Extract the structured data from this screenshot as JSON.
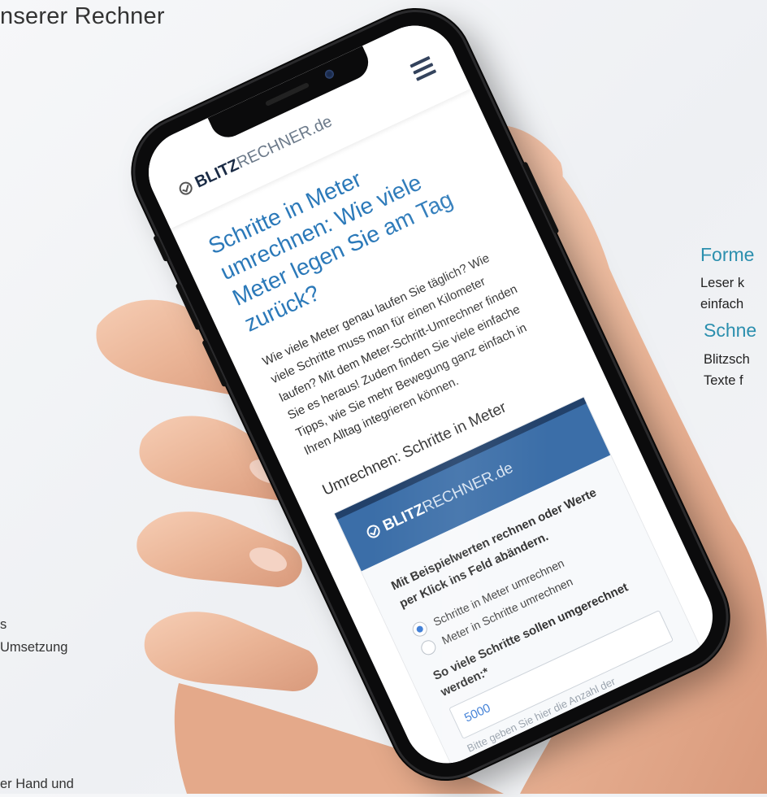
{
  "page": {
    "heading": "nserer Rechner",
    "features": [
      {
        "title": "Forme",
        "text_lines": [
          "Leser k",
          "einfach"
        ]
      },
      {
        "title": "Schne",
        "text_lines": [
          "Blitzsch",
          "Texte f"
        ]
      }
    ],
    "side_texts": [
      "s",
      "Umsetzung",
      "er Hand und"
    ]
  },
  "phone": {
    "logo": {
      "bold": "BLITZ",
      "light": "RECHNER.de"
    },
    "article": {
      "title": "Schritte in Meter umrechnen: Wie viele Meter legen Sie am Tag zurück?",
      "text": "Wie viele Meter genau laufen Sie täglich? Wie viele Schritte muss man für einen Kilometer laufen? Mit dem Meter-Schritt-Umrechner finden Sie es heraus! Zudem finden Sie viele einfache Tipps, wie Sie mehr Bewegung ganz einfach in Ihren Alltag integrieren können."
    },
    "section_title": "Umrechnen: Schritte in Meter",
    "calculator": {
      "logo": {
        "bold": "BLITZ",
        "light": "RECHNER.de"
      },
      "intro": "Mit Beispielwerten rechnen oder Werte per Klick ins Feld abändern.",
      "options": [
        {
          "label": "Schritte in Meter umrechnen",
          "checked": true
        },
        {
          "label": "Meter in Schritte umrechnen",
          "checked": false
        }
      ],
      "field_label": "So viele Schritte sollen umgerechnet werden:*",
      "field_value": "5000",
      "field_hint": "Bitte geben Sie hier die Anzahl der"
    }
  },
  "colors": {
    "accent": "#2b8fae",
    "title_blue": "#2b79b9",
    "calc_header": "#3b6ea8"
  }
}
